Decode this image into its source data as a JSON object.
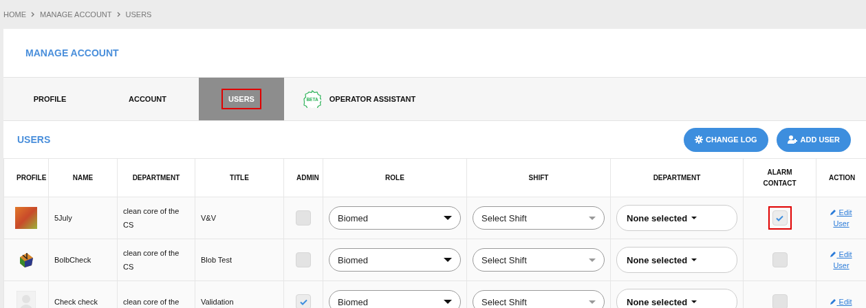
{
  "breadcrumb": [
    "HOME",
    "MANAGE ACCOUNT",
    "USERS"
  ],
  "page_title": "MANAGE ACCOUNT",
  "tabs": [
    {
      "label": "PROFILE",
      "selected": false,
      "highlighted": false
    },
    {
      "label": "ACCOUNT",
      "selected": false,
      "highlighted": false
    },
    {
      "label": "USERS",
      "selected": true,
      "highlighted": true
    },
    {
      "label": "OPERATOR ASSISTANT",
      "selected": false,
      "highlighted": false,
      "badge": "BETA"
    }
  ],
  "section_title": "USERS",
  "buttons": [
    {
      "kind": "gear",
      "label": "CHANGE LOG"
    },
    {
      "kind": "add-user",
      "label": "ADD USER"
    }
  ],
  "table": {
    "columns": [
      "PROFILE",
      "NAME",
      "DEPARTMENT",
      "TITLE",
      "ADMIN",
      "ROLE",
      "SHIFT",
      "DEPARTMENT",
      "ALARM CONTACT",
      "ACTION"
    ],
    "rows": [
      {
        "kind": "photo",
        "name": "5July",
        "department": "clean core of the CS",
        "title": "V&V",
        "admin": false,
        "role": "Biomed",
        "shift": "Select Shift",
        "department_select": "None selected",
        "alarm_contact": true,
        "alarm_highlighted": true,
        "action": "Edit User"
      },
      {
        "kind": "cube",
        "name": "BolbCheck",
        "department": "clean core of the CS",
        "title": "Blob Test",
        "admin": false,
        "role": "Biomed",
        "shift": "Select Shift",
        "department_select": "None selected",
        "alarm_contact": false,
        "alarm_highlighted": false,
        "action": "Edit User"
      },
      {
        "kind": "silhouette",
        "name": "Check check",
        "department": "clean core of the",
        "title": "Validation",
        "admin": true,
        "role": "Biomed",
        "shift": "Select Shift",
        "department_select": "None selected",
        "alarm_contact": false,
        "alarm_highlighted": false,
        "action": "Edit"
      }
    ]
  }
}
